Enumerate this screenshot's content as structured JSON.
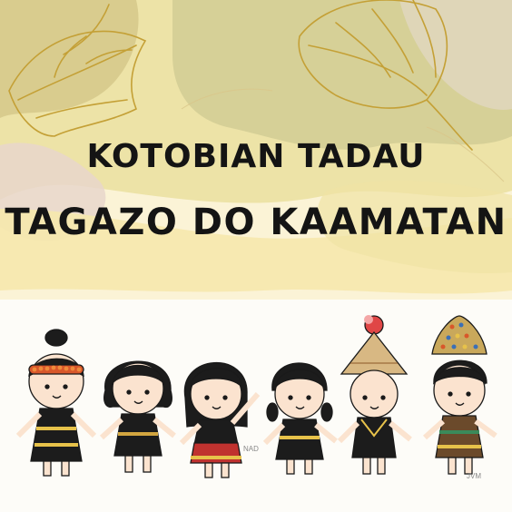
{
  "poster": {
    "title_line_1": "KOTOBIAN TADAU",
    "title_line_2": "TAGAZO DO KAAMATAN"
  },
  "illustration": {
    "characters": [
      {
        "name": "figure-red-beaded-headband"
      },
      {
        "name": "figure-short-hair-black-outfit"
      },
      {
        "name": "figure-waving-red-skirt"
      },
      {
        "name": "figure-braids-black-outfit"
      },
      {
        "name": "figure-conical-hat"
      },
      {
        "name": "figure-tall-beaded-headdress"
      }
    ],
    "artist_signature_1": "NAD",
    "artist_signature_2": "JVM"
  },
  "colors": {
    "background": "#fdfcf8",
    "wash_yellow": "#f6e7a8",
    "wash_olive": "#cdc58a",
    "wash_pink": "#eedcd3",
    "leaf_outline": "#c9a43c",
    "title_text": "#141414",
    "headband_red": "#d8572a",
    "skirt_red": "#c0322f",
    "garment_black": "#1c1c1c"
  }
}
